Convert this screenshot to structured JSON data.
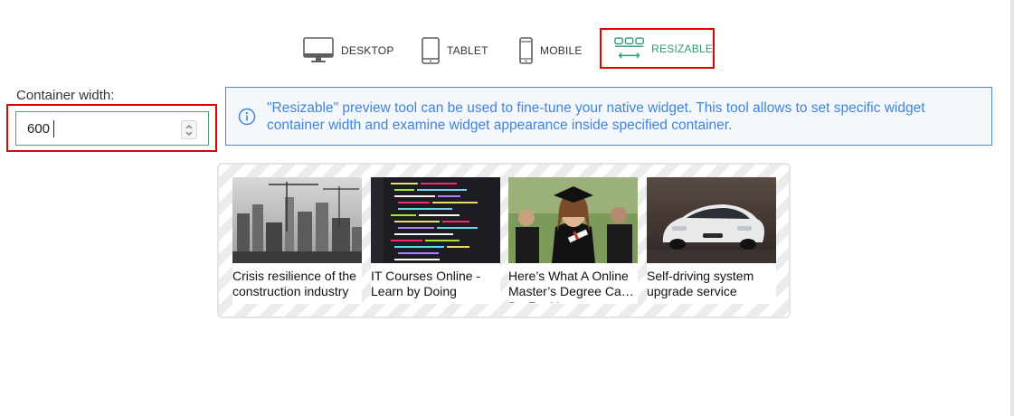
{
  "devices": {
    "desktop": {
      "label": "DESKTOP",
      "icon": "desktop-monitor-icon"
    },
    "tablet": {
      "label": "TABLET",
      "icon": "tablet-icon"
    },
    "mobile": {
      "label": "MOBILE",
      "icon": "mobile-phone-icon"
    },
    "resizable": {
      "label": "RESIZABLE",
      "icon": "resizable-width-icon",
      "selected": true
    }
  },
  "container_width": {
    "label": "Container width:",
    "value": "600"
  },
  "info": {
    "icon": "info-icon",
    "text": "\"Resizable\" preview tool can be used to fine-tune your native widget. This tool allows to set specific widget container width and examine widget appearance inside specified container."
  },
  "widget": {
    "cards": [
      {
        "title": "Crisis resilience of the construction industry",
        "image": "construction-cranes-image"
      },
      {
        "title": "IT Courses Online - Learn by Doing",
        "image": "code-screen-image"
      },
      {
        "title": "Here’s What A Online Master’s Degree Can Do For You",
        "image": "graduate-woman-image"
      },
      {
        "title": "Self-driving system upgrade service",
        "image": "white-electric-car-image"
      }
    ]
  },
  "colors": {
    "accent_green": "#2c9c77",
    "highlight_red": "#e00000",
    "info_blue": "#3f84d9"
  }
}
